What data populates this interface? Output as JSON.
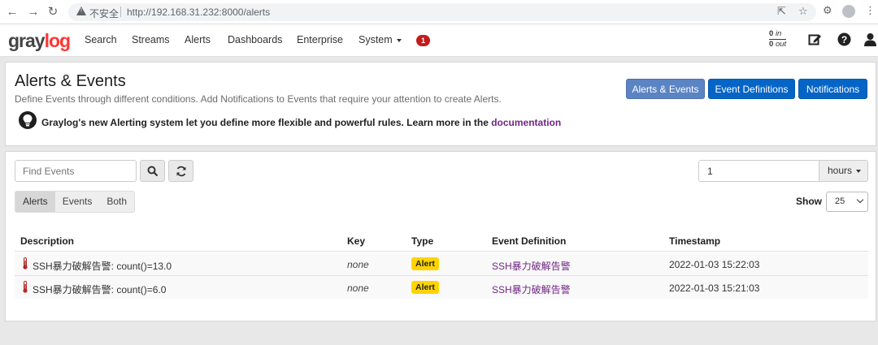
{
  "browser": {
    "insecure_label": "不安全",
    "url": "http://192.168.31.232:8000/alerts"
  },
  "nav": {
    "logo_part1": "gray",
    "logo_part2": "log",
    "items": [
      "Search",
      "Streams",
      "Alerts",
      "Dashboards",
      "Enterprise",
      "System"
    ],
    "notification_count": "1",
    "throughput_in": "0",
    "throughput_in_unit": "in",
    "throughput_out": "0",
    "throughput_out_unit": "out"
  },
  "header": {
    "title": "Alerts & Events",
    "description": "Define Events through different conditions. Add Notifications to Events that require your attention to create Alerts.",
    "buttons": [
      "Alerts & Events",
      "Event Definitions",
      "Notifications"
    ],
    "notice": "Graylog's new Alerting system let you define more flexible and powerful rules. Learn more in the ",
    "notice_link": "documentation"
  },
  "controls": {
    "search_placeholder": "Find Events",
    "range_value": "1",
    "range_unit": "hours",
    "filters": [
      "Alerts",
      "Events",
      "Both"
    ],
    "active_filter": "Alerts",
    "show_label": "Show",
    "show_value": "25"
  },
  "table": {
    "headers": [
      "Description",
      "Key",
      "Type",
      "Event Definition",
      "Timestamp"
    ],
    "rows": [
      {
        "description": "SSH暴力破解告警: count()=13.0",
        "key": "none",
        "type": "Alert",
        "definition": "SSH暴力破解告警",
        "timestamp": "2022-01-03 15:22:03"
      },
      {
        "description": "SSH暴力破解告警: count()=6.0",
        "key": "none",
        "type": "Alert",
        "definition": "SSH暴力破解告警",
        "timestamp": "2022-01-03 15:21:03"
      }
    ]
  },
  "colors": {
    "accent": "#0565c7",
    "accent_active": "#5b84c4",
    "logo_red": "#ff3633",
    "alert_label": "#ffd400",
    "link": "#702785"
  }
}
